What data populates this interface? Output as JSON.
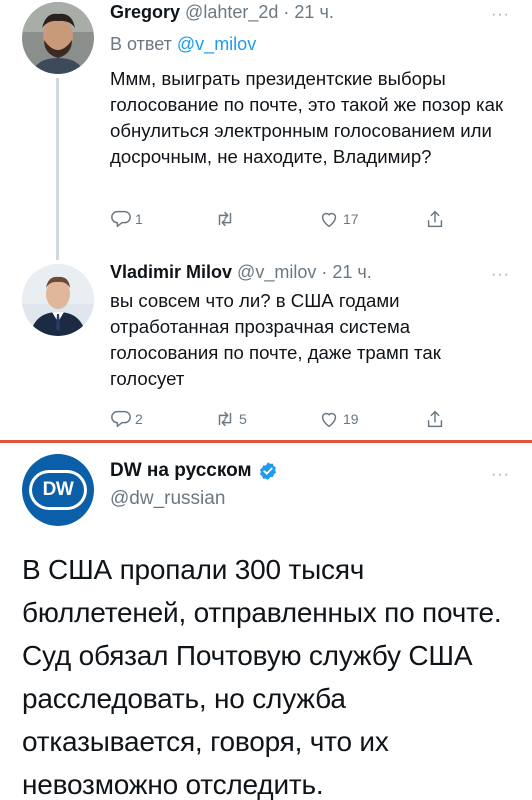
{
  "tweets": [
    {
      "name": "Gregory",
      "handle": "@lahter_2d",
      "dot": "·",
      "time": "21 ч.",
      "reply_prefix": "В ответ",
      "reply_mention": "@v_milov",
      "text": "Ммм, выиграть президентские выборы голосование по почте, это такой же позор как обнулиться электронным голосованием или досрочным, не находите, Владимир?",
      "replies": "1",
      "retweets": "",
      "likes": "17"
    },
    {
      "name": "Vladimir Milov",
      "handle": "@v_milov",
      "dot": "·",
      "time": "21 ч.",
      "text": "вы совсем что ли? в США годами отработанная прозрачная система голосования по почте, даже трамп так голосует",
      "replies": "2",
      "retweets": "5",
      "likes": "19"
    }
  ],
  "more_label": "···",
  "dw": {
    "logo_text": "DW",
    "name": "DW на русском",
    "handle": "@dw_russian",
    "text": "В США пропали 300 тысяч бюллетеней, отправленных по почте. Суд обязал Почтовую службу США расследовать, но служба отказывается, говоря, что их невозможно отследить."
  },
  "icons": {
    "reply": "reply-icon",
    "retweet": "retweet-icon",
    "like": "heart-icon",
    "share": "share-icon",
    "verified": "verified-badge-icon"
  },
  "colors": {
    "link": "#1d9bf0",
    "secondary_text": "#6b7882",
    "divider": "#e0533d",
    "dw_blue": "#0b5ea8"
  }
}
